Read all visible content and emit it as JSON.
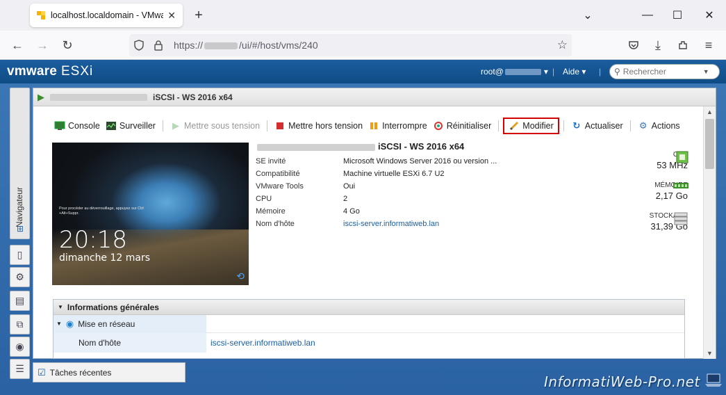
{
  "browser": {
    "tab_title": "localhost.localdomain - VMware",
    "url": "https://",
    "url_path": "/ui/#/host/vms/240"
  },
  "esxi": {
    "brand": "vmware",
    "product": "ESXi",
    "user": "root@",
    "help": "Aide",
    "search_placeholder": "Rechercher"
  },
  "vm": {
    "name": "iSCSI - WS 2016 x64",
    "toolbar": [
      {
        "label": "Console",
        "icon": "console-icon"
      },
      {
        "label": "Surveiller",
        "icon": "monitor-icon"
      },
      {
        "label": "Mettre sous tension",
        "icon": "power-on-icon",
        "disabled": true
      },
      {
        "label": "Mettre hors tension",
        "icon": "power-off-icon"
      },
      {
        "label": "Interrompre",
        "icon": "suspend-icon"
      },
      {
        "label": "Réinitialiser",
        "icon": "reset-icon"
      },
      {
        "label": "Modifier",
        "icon": "edit-icon",
        "highlighted": true
      },
      {
        "label": "Actualiser",
        "icon": "refresh-icon"
      },
      {
        "label": "Actions",
        "icon": "gear-icon"
      }
    ],
    "screen": {
      "hint": "Pour procéder au déverrouillage, appuyez sur Ctrl +Alt+Suppr.",
      "time": "20:18",
      "date": "dimanche 12 mars"
    },
    "info": [
      {
        "label": "SE invité",
        "value": "Microsoft Windows Server 2016 ou version ..."
      },
      {
        "label": "Compatibilité",
        "value": "Machine virtuelle ESXi 6.7 U2"
      },
      {
        "label": "VMware Tools",
        "value": "Oui"
      },
      {
        "label": "CPU",
        "value": "2"
      },
      {
        "label": "Mémoire",
        "value": "4 Go"
      },
      {
        "label": "Nom d'hôte",
        "value": "iscsi-server.informatiweb.lan",
        "link": true
      }
    ],
    "resources": {
      "cpu_label": "CPU",
      "cpu_value": "53 MHz",
      "mem_label": "MÉMOIRE",
      "mem_value": "2,17 Go",
      "storage_label": "STOCKAGE",
      "storage_value": "31,39 Go"
    },
    "general": {
      "title": "Informations générales",
      "network": "Mise en réseau",
      "hostname_label": "Nom d'hôte",
      "hostname_value": "iscsi-server.informatiweb.lan"
    }
  },
  "navigator": "Navigateur",
  "tasks": "Tâches récentes",
  "watermark": "InformatiWeb-Pro.net",
  "colors": {
    "esxi_blue": "#1b5d9e",
    "highlight_red": "#d40000",
    "link": "#1a5fa3"
  }
}
